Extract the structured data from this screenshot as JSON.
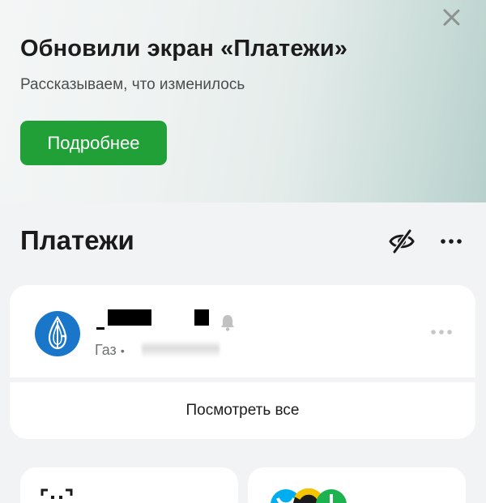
{
  "banner": {
    "title": "Обновили экран «Платежи»",
    "subtitle": "Рассказываем, что изменилось",
    "button_label": "Подробнее",
    "close_icon": "close-icon",
    "button_color": "#21a038"
  },
  "payments": {
    "title": "Платежи",
    "hide_icon": "eye-crossed-icon",
    "more_icon": "more-horizontal-icon",
    "item": {
      "logo_icon": "gazprom-logo-icon",
      "category": "Газ",
      "separator": "•",
      "bell_icon": "bell-icon",
      "more_icon": "more-horizontal-icon"
    },
    "see_all_label": "Посмотреть все"
  },
  "tiles": {
    "left_icon": "qr-scan-icon",
    "right_icon": "operator-logos-icon"
  }
}
